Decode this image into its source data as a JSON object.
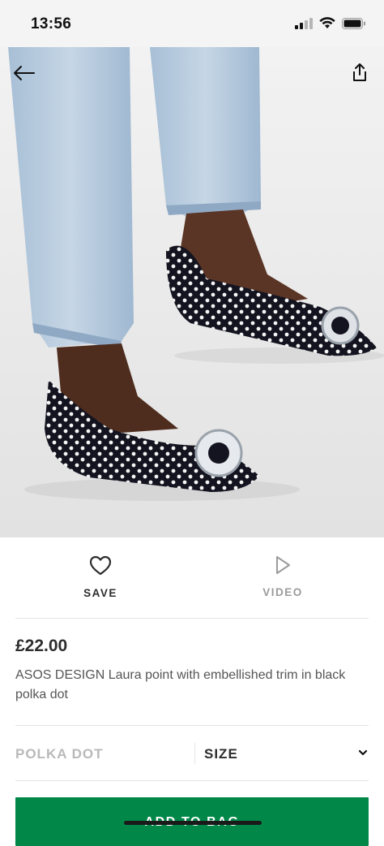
{
  "status_bar": {
    "time": "13:56"
  },
  "hero": {
    "image_alt": "Polka dot pointed flats with embellished trim worn with light blue jeans"
  },
  "actions": {
    "save_label": "SAVE",
    "video_label": "VIDEO"
  },
  "product": {
    "price": "£22.00",
    "title": "ASOS DESIGN Laura point with embellished trim in black polka dot"
  },
  "options": {
    "colour": "POLKA DOT",
    "size_label": "SIZE"
  },
  "cta": {
    "add_to_bag": "ADD TO BAG"
  },
  "colors": {
    "primary": "#018849",
    "text": "#2d2d2d",
    "muted": "#b9b9b9"
  }
}
